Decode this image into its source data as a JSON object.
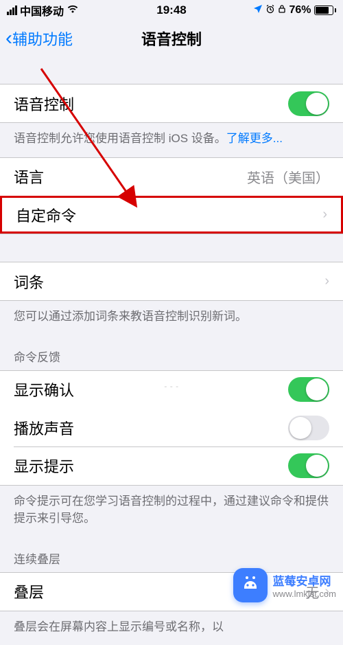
{
  "status": {
    "carrier": "中国移动",
    "time": "19:48",
    "battery_pct": "76%"
  },
  "nav": {
    "back_label": "辅助功能",
    "title": "语音控制"
  },
  "voice_control": {
    "label": "语音控制",
    "footer_text": "语音控制允许您使用语音控制 iOS 设备。",
    "learn_more": "了解更多..."
  },
  "language": {
    "label": "语言",
    "value": "英语（美国）"
  },
  "custom_commands": {
    "label": "自定命令"
  },
  "vocabulary": {
    "label": "词条",
    "footer": "您可以通过添加词条来教语音控制识别新词。"
  },
  "feedback_header": "命令反馈",
  "feedback": {
    "confirm": {
      "label": "显示确认",
      "on": true
    },
    "sound": {
      "label": "播放声音",
      "on": false
    },
    "hints": {
      "label": "显示提示",
      "on": true
    },
    "footer": "命令提示可在您学习语音控制的过程中，通过建议命令和提供提示来引导您。"
  },
  "overlay_header": "连续叠层",
  "overlay": {
    "label": "叠层",
    "value": "无",
    "footer": "叠层会在屏幕内容上显示编号或名称，以"
  },
  "watermark": "- - -",
  "brand": {
    "name": "蓝莓安卓网",
    "url": "www.lmkjst.com"
  }
}
